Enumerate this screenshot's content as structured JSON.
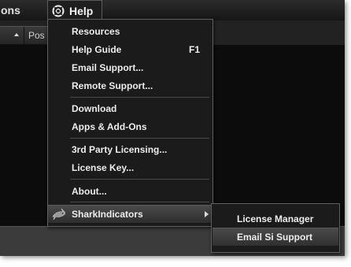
{
  "menubar": {
    "previous_menu_label": "ons",
    "help_label": "Help"
  },
  "column_header": {
    "label": "Pos"
  },
  "help_menu": {
    "items": [
      {
        "label": "Resources",
        "shortcut": ""
      },
      {
        "label": "Help Guide",
        "shortcut": "F1"
      },
      {
        "label": "Email Support...",
        "shortcut": ""
      },
      {
        "label": "Remote Support...",
        "shortcut": ""
      },
      {
        "label": "Download",
        "shortcut": ""
      },
      {
        "label": "Apps & Add-Ons",
        "shortcut": ""
      },
      {
        "label": "3rd Party Licensing...",
        "shortcut": ""
      },
      {
        "label": "License Key...",
        "shortcut": ""
      },
      {
        "label": "About...",
        "shortcut": ""
      },
      {
        "label": "SharkIndicators",
        "shortcut": "",
        "icon": "shark-icon",
        "has_submenu": true
      }
    ]
  },
  "submenu": {
    "items": [
      {
        "label": "License Manager"
      },
      {
        "label": "Email Si Support"
      }
    ]
  }
}
